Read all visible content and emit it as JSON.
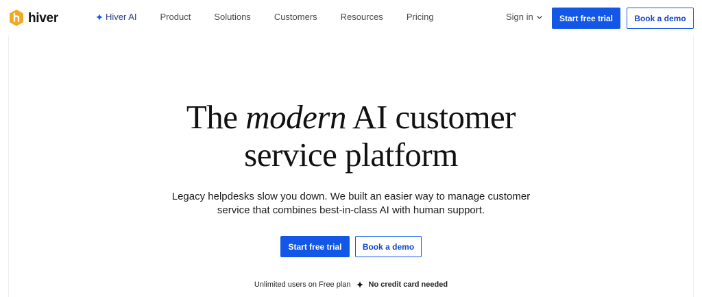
{
  "brand": {
    "name": "hiver",
    "logo_color": "#f5a623"
  },
  "nav": {
    "items": [
      {
        "label": "Hiver AI",
        "icon": "sparkle-icon"
      },
      {
        "label": "Product"
      },
      {
        "label": "Solutions"
      },
      {
        "label": "Customers"
      },
      {
        "label": "Resources"
      },
      {
        "label": "Pricing"
      }
    ],
    "sign_in": "Sign in",
    "start_trial": "Start free trial",
    "book_demo": "Book a demo"
  },
  "hero": {
    "title_part1": "The ",
    "title_emphasis": "modern",
    "title_part2": " AI customer",
    "title_line2": "service platform",
    "subtitle_line1": "Legacy helpdesks slow you down. We built an easier way to manage customer",
    "subtitle_line2": "service that combines best-in-class AI with human support.",
    "start_trial": "Start free trial",
    "book_demo": "Book a demo",
    "note_left": "Unlimited users on Free plan",
    "note_right": "No credit card needed"
  },
  "colors": {
    "accent": "#1257e6",
    "ai_link": "#2c3b8f",
    "text": "#111111"
  }
}
